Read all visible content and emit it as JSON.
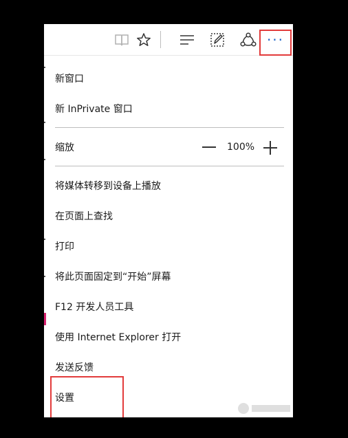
{
  "toolbar": {
    "icons": [
      "reading-view-icon",
      "favorite-star-icon",
      "hub-icon",
      "web-note-icon",
      "share-icon",
      "more-dots-icon"
    ],
    "more_label": "···"
  },
  "menu": {
    "new_window": "新窗口",
    "new_inprivate": "新 InPrivate 窗口",
    "zoom_label": "缩放",
    "zoom_value": "100%",
    "cast_media": "将媒体转移到设备上播放",
    "find_on_page": "在页面上查找",
    "print": "打印",
    "pin_to_start": "将此页面固定到“开始”屏幕",
    "f12_tools": "F12 开发人员工具",
    "open_with_ie": "使用 Internet Explorer 打开",
    "send_feedback": "发送反馈",
    "settings": "设置"
  },
  "colors": {
    "highlight_border": "#e23a3a",
    "more_dots": "#1e64c8",
    "background": "#000000",
    "menu_bg": "#ffffff",
    "separator": "#bdbdbd"
  }
}
